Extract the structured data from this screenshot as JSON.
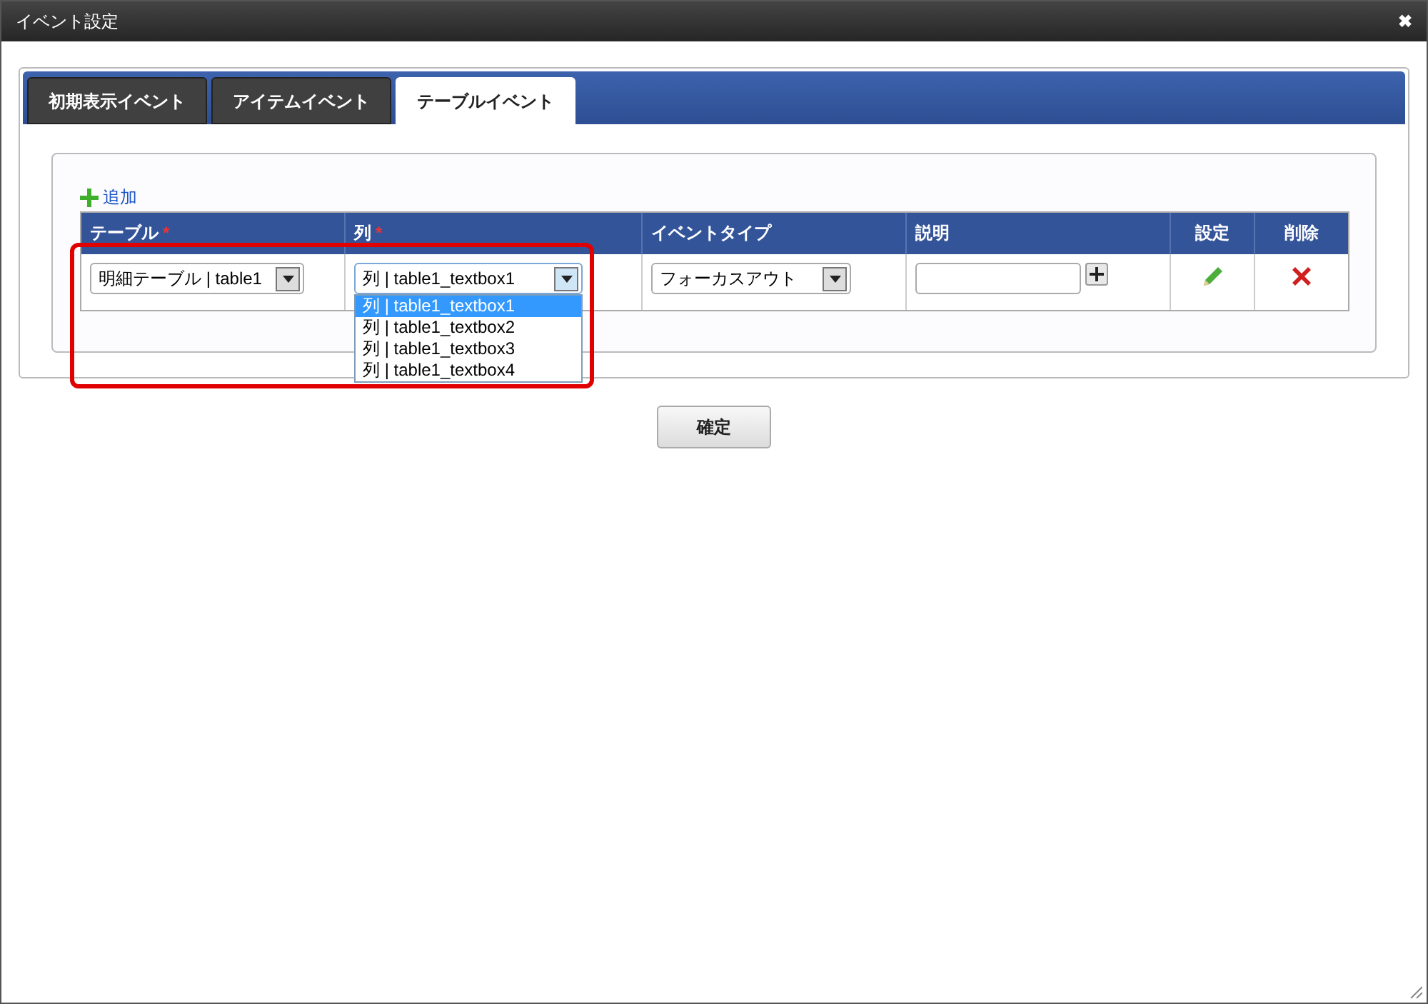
{
  "window": {
    "title": "イベント設定",
    "close": "✖"
  },
  "tabs": [
    {
      "label": "初期表示イベント",
      "selected": false
    },
    {
      "label": "アイテムイベント",
      "selected": false
    },
    {
      "label": "テーブルイベント",
      "selected": true
    }
  ],
  "add_link": "追加",
  "table": {
    "columns": [
      {
        "label": "テーブル",
        "required": true
      },
      {
        "label": "列",
        "required": true
      },
      {
        "label": "イベントタイプ",
        "required": false
      },
      {
        "label": "説明",
        "required": false
      },
      {
        "label": "設定",
        "required": false
      },
      {
        "label": "削除",
        "required": false
      }
    ],
    "required_mark": "*",
    "rows": [
      {
        "table": "明細テーブル | table1",
        "column": "列 | table1_textbox1",
        "event_type": "フォーカスアウト"
      }
    ]
  },
  "column_dropdown": {
    "open": true,
    "options": [
      {
        "label": "列 | table1_textbox1",
        "selected": true
      },
      {
        "label": "列 | table1_textbox2",
        "selected": false
      },
      {
        "label": "列 | table1_textbox3",
        "selected": false
      },
      {
        "label": "列 | table1_textbox4",
        "selected": false
      }
    ]
  },
  "highlight": true,
  "confirm_button": "確定"
}
